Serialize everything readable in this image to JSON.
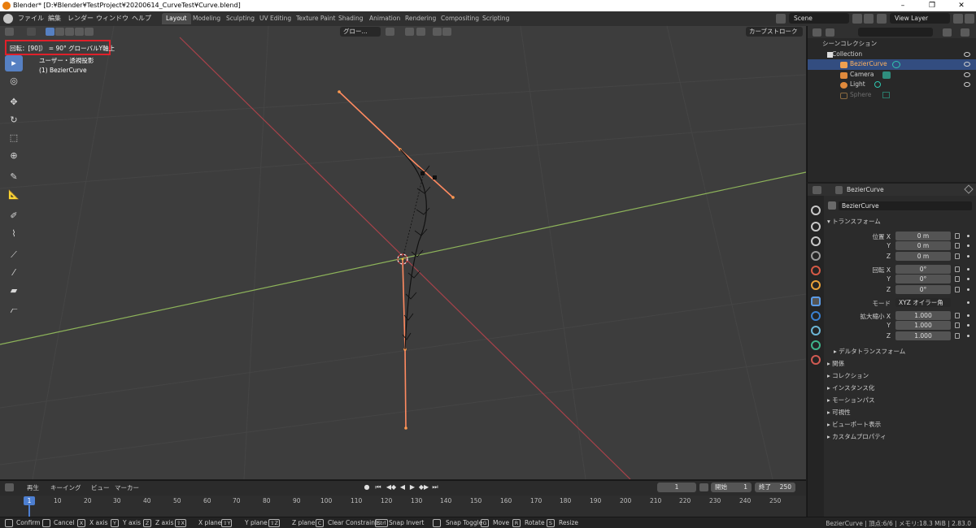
{
  "window": {
    "title": "Blender* [D:¥Blender¥TestProject¥20200614_CurveTest¥Curve.blend]",
    "min_glyph": "–",
    "max_glyph": "❐",
    "close_glyph": "✕"
  },
  "menu": {
    "items": [
      "ファイル",
      "編集",
      "レンダー",
      "ウィンドウ",
      "ヘルプ"
    ]
  },
  "workspaces": [
    "Layout",
    "Modeling",
    "Sculpting",
    "UV Editing",
    "Texture Paint",
    "Shading",
    "Animation",
    "Rendering",
    "Compositing",
    "Scripting"
  ],
  "active_workspace": "Layout",
  "scene_field": "Scene",
  "viewlayer_field": "View Layer",
  "viewport": {
    "operator_status": "回転：[90]） = 90°  グローバルY軸上",
    "view_label": "ユーザー・透視投影",
    "object_label": "(1) BezierCurve",
    "orientation": "グロー...",
    "curve_stroke": "カーブストローク",
    "tools": [
      {
        "icon": "select-box-icon",
        "glyph": "▸"
      },
      {
        "icon": "cursor-icon",
        "glyph": "◎"
      },
      {
        "icon": "move-icon",
        "glyph": "✥"
      },
      {
        "icon": "rotate-icon",
        "glyph": "↻"
      },
      {
        "icon": "scale-icon",
        "glyph": "⬚"
      },
      {
        "icon": "transform-icon",
        "glyph": "⊕"
      },
      {
        "icon": "annotate-icon",
        "glyph": "✎"
      },
      {
        "icon": "measure-icon",
        "glyph": "📐"
      },
      {
        "icon": "draw-icon",
        "glyph": "✐"
      },
      {
        "icon": "curve-pen-icon",
        "glyph": "⌇"
      },
      {
        "icon": "tilt-icon",
        "glyph": "⟋"
      },
      {
        "icon": "radius-icon",
        "glyph": "⁄"
      },
      {
        "icon": "extrude-icon",
        "glyph": "▰"
      },
      {
        "icon": "randomize-icon",
        "glyph": "⦧"
      }
    ]
  },
  "timeline": {
    "menus": [
      "再生",
      "キーイング",
      "ビュー",
      "マーカー"
    ],
    "current_frame": "1",
    "frame_field": "1",
    "start_label": "開始",
    "start_value": "1",
    "end_label": "終了",
    "end_value": "250",
    "ticks": [
      "10",
      "20",
      "30",
      "40",
      "50",
      "60",
      "70",
      "80",
      "90",
      "100",
      "110",
      "120",
      "130",
      "140",
      "150",
      "160",
      "170",
      "180",
      "190",
      "200",
      "210",
      "220",
      "230",
      "240",
      "250"
    ],
    "playback_buttons": [
      "●",
      "⏮",
      "◀◆",
      "◀",
      "▶",
      "◆▶",
      "⏭"
    ]
  },
  "outliner": {
    "search_placeholder": "",
    "rows": [
      {
        "label": "シーンコレクション",
        "indent": 0,
        "state": "normal"
      },
      {
        "label": "Collection",
        "indent": 1,
        "state": "normal"
      },
      {
        "label": "BezierCurve",
        "indent": 2,
        "state": "selected"
      },
      {
        "label": "Camera",
        "indent": 2,
        "state": "normal"
      },
      {
        "label": "Light",
        "indent": 2,
        "state": "normal"
      },
      {
        "label": "Sphere",
        "indent": 2,
        "state": "dim"
      }
    ]
  },
  "properties": {
    "header_object": "BezierCurve",
    "object_name": "BezierCurve",
    "transform_title": "トランスフォーム",
    "location_label": "位置 X",
    "location": [
      "0 m",
      "0 m",
      "0 m"
    ],
    "rotation_label": "回転 X",
    "rotation": [
      "0°",
      "0°",
      "0°"
    ],
    "axis_y": "Y",
    "axis_z": "Z",
    "mode_label": "モード",
    "mode_value": "XYZ オイラー角",
    "scale_label": "拡大縮小 X",
    "scale": [
      "1.000",
      "1.000",
      "1.000"
    ],
    "delta_transform": "デルタトランスフォーム",
    "sections": [
      "関係",
      "コレクション",
      "インスタンス化",
      "モーションパス",
      "可視性",
      "ビューポート表示",
      "カスタムプロパティ"
    ],
    "tab_colors": [
      "#c8c8c8",
      "#c8c8c8",
      "#c8c8c8",
      "#9a9a9a",
      "#d65a46",
      "#e8a13a",
      "#5b9be6",
      "#3a80d0",
      "#6cb6d6",
      "#3fb48a",
      "#d05a52"
    ]
  },
  "statusbar": {
    "items": [
      {
        "key": "",
        "label": "Confirm"
      },
      {
        "key": "",
        "label": "Cancel"
      },
      {
        "key": "X",
        "label": "X axis"
      },
      {
        "key": "Y",
        "label": "Y axis"
      },
      {
        "key": "Z",
        "label": "Z axis"
      },
      {
        "key": "⇧X",
        "label": "X plane"
      },
      {
        "key": "⇧Y",
        "label": "Y plane"
      },
      {
        "key": "⇧Z",
        "label": "Z plane"
      },
      {
        "key": "C",
        "label": "Clear Constraints"
      },
      {
        "key": "Ctrl",
        "label": "Snap Invert"
      },
      {
        "key": "",
        "label": "Snap Toggle"
      },
      {
        "key": "G",
        "label": "Move"
      },
      {
        "key": "R",
        "label": "Rotate"
      },
      {
        "key": "S",
        "label": "Resize"
      }
    ],
    "stats": "BezierCurve | 頂点:6/6 | メモリ:18.3 MiB | 2.83.0"
  },
  "colors": {
    "x_axis": "#a8424a",
    "y_axis": "#8db35a",
    "selected_curve": "#ff8a60",
    "accent": "#5680c2",
    "highlight_box": "#e0202a"
  }
}
